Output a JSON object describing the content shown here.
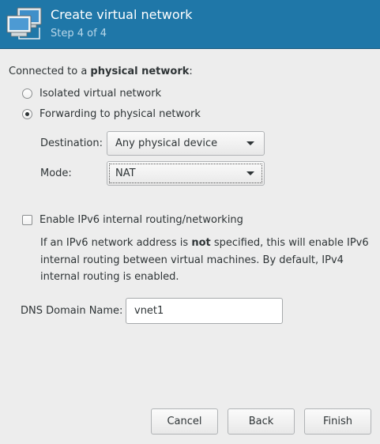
{
  "header": {
    "title": "Create virtual network",
    "subtitle": "Step 4 of 4",
    "icon": "virtual-network-computers-icon"
  },
  "network": {
    "label_prefix": "Connected to a ",
    "label_bold": "physical network",
    "label_suffix": ":",
    "options": [
      {
        "label": "Isolated virtual network",
        "selected": false
      },
      {
        "label": "Forwarding to physical network",
        "selected": true
      }
    ],
    "destination": {
      "label": "Destination:",
      "value": "Any physical device"
    },
    "mode": {
      "label": "Mode:",
      "value": "NAT"
    }
  },
  "ipv6": {
    "label": "Enable IPv6 internal routing/networking",
    "checked": false,
    "info_part1": "If an IPv6 network address is ",
    "info_bold": "not",
    "info_part2": " specified, this will enable IPv6 internal routing between virtual machines.  By default, IPv4 internal routing is enabled."
  },
  "dns": {
    "label": "DNS Domain Name:",
    "value": "vnet1"
  },
  "buttons": {
    "cancel": "Cancel",
    "back": "Back",
    "finish": "Finish"
  },
  "colors": {
    "header_bg": "#1f77a8",
    "header_subtitle": "#b9d8ea",
    "window_bg": "#ededed"
  }
}
